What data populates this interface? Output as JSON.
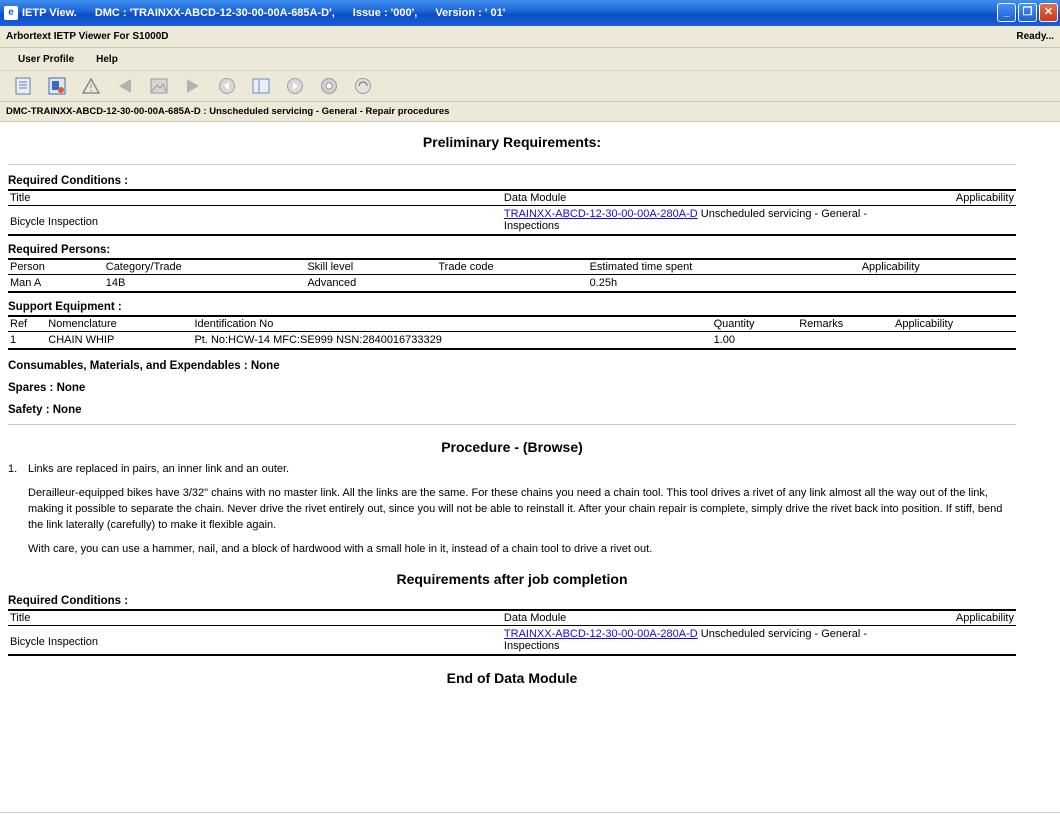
{
  "window": {
    "title": "IETP View.",
    "dmc": "DMC : 'TRAINXX-ABCD-12-30-00-00A-685A-D',",
    "issue": "Issue : '000',",
    "version": "Version : ' 01'",
    "minimize": "_",
    "maximize": "❐",
    "close": "✕"
  },
  "appbar": {
    "name": "Arbortext IETP Viewer For S1000D",
    "status": "Ready..."
  },
  "menu": {
    "user_profile": "User Profile",
    "help": "Help"
  },
  "toolbar": {
    "icons": [
      "document-icon",
      "bookmark-icon",
      "warning-icon",
      "previous-icon",
      "image-icon",
      "next-icon",
      "back-icon",
      "toc-icon",
      "forward-icon",
      "settings-icon",
      "print-icon"
    ]
  },
  "breadcrumb": "DMC-TRAINXX-ABCD-12-30-00-00A-685A-D : Unscheduled servicing - General - Repair procedures",
  "prelim": {
    "title": "Preliminary Requirements:",
    "conditions_label": "Required Conditions :",
    "conditions_headers": {
      "title": "Title",
      "dm": "Data Module",
      "applic": "Applicability"
    },
    "condition_row": {
      "title": "Bicycle Inspection",
      "link": "TRAINXX-ABCD-12-30-00-00A-280A-D",
      "desc": " Unscheduled servicing - General - Inspections"
    },
    "persons_label": "Required Persons:",
    "persons_headers": [
      "Person",
      "Category/Trade",
      "Skill level",
      "Trade code",
      "Estimated time spent",
      "Applicability"
    ],
    "persons_row": [
      "Man A",
      "14B",
      "Advanced",
      "",
      "0.25h",
      ""
    ],
    "equip_label": "Support Equipment :",
    "equip_headers": [
      "Ref",
      "Nomenclature",
      "Identification No",
      "Quantity",
      "Remarks",
      "Applicability"
    ],
    "equip_row": [
      "1",
      "CHAIN WHIP",
      "Pt. No:HCW-14 MFC:SE999 NSN:2840016733329",
      "1.00",
      "",
      ""
    ],
    "consumables": "Consumables, Materials, and Expendables : None",
    "spares": "Spares : None",
    "safety": "Safety : None"
  },
  "procedure": {
    "title": "Procedure - (Browse)",
    "step_num": "1.",
    "step_text": "Links are replaced in pairs, an inner link and an outer.",
    "para1": "Derailleur-equipped bikes have 3/32\" chains with no master link. All the links are the same. For these chains you need a chain tool. This tool drives a rivet of any link almost all the way out of the link, making it possible to separate the chain. Never drive the rivet entirely out, since you will not be able to reinstall it. After your chain repair is complete, simply drive the rivet back into position. If stiff, bend the link laterally (carefully) to make it flexible again.",
    "para2": "With care, you can use a hammer, nail, and a block of hardwood with a small hole in it, instead of a chain tool to drive a rivet out."
  },
  "after": {
    "title": "Requirements after job completion",
    "conditions_label": "Required Conditions :",
    "conditions_headers": {
      "title": "Title",
      "dm": "Data Module",
      "applic": "Applicability"
    },
    "condition_row": {
      "title": "Bicycle Inspection",
      "link": "TRAINXX-ABCD-12-30-00-00A-280A-D",
      "desc": " Unscheduled servicing - General - Inspections"
    }
  },
  "end": "End of Data Module"
}
